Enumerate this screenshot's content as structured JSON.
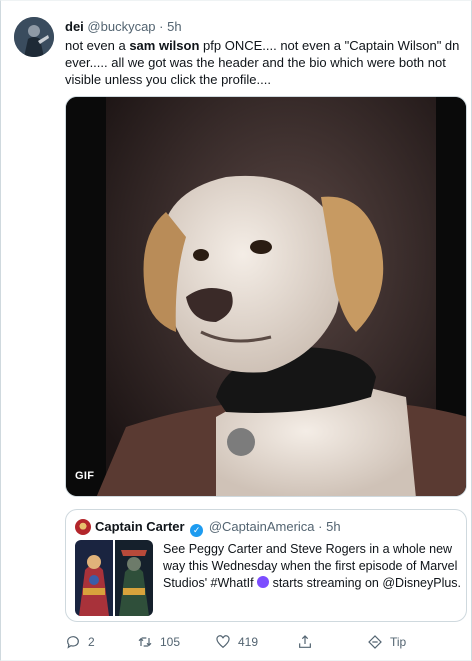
{
  "author": {
    "display_name": "dei",
    "handle": "@buckycap",
    "separator": "·",
    "time": "5h"
  },
  "tweet": {
    "text_part1": "not even a ",
    "bold1": "sam wilson",
    "text_part2": " pfp ONCE.... not even a \"Captain Wilson\" dn ever..... all we got was the header and the bio which were both not visible unless you click the profile...."
  },
  "media": {
    "badge": "GIF"
  },
  "quote": {
    "display_name": "Captain Carter",
    "handle": "@CaptainAmerica",
    "separator": "·",
    "time": "5h",
    "text": "See Peggy Carter and Steve Rogers in a whole new way this Wednesday when the first episode of Marvel Studios' #WhatIf",
    "text_after": " starts streaming on @DisneyPlus."
  },
  "actions": {
    "reply_count": "2",
    "retweet_count": "105",
    "like_count": "419",
    "tip_label": "Tip"
  },
  "colors": {
    "accent": "#1d9bf0",
    "secondary_text": "#536471",
    "border": "#cfd9de"
  }
}
